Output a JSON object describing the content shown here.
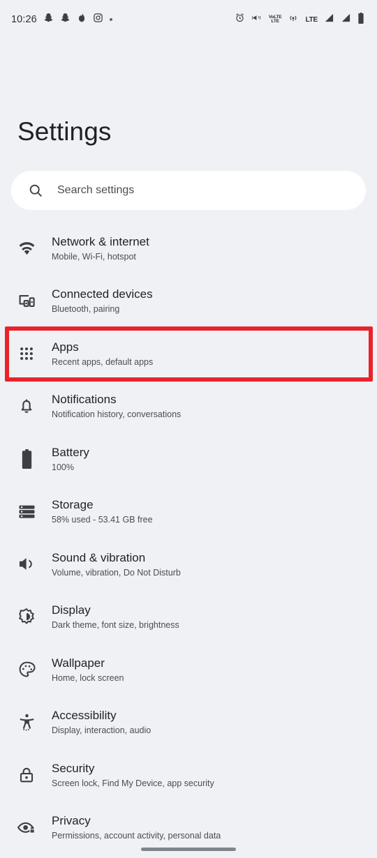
{
  "status_bar": {
    "time": "10:26",
    "left_icons": [
      {
        "name": "snapchat-icon",
        "label": "Snapchat"
      },
      {
        "name": "snapchat-icon",
        "label": "Snapchat"
      },
      {
        "name": "tinder-flame-icon",
        "label": "Tinder"
      },
      {
        "name": "instagram-icon",
        "label": "Instagram"
      },
      {
        "name": "more-notifications-dot-icon",
        "label": "More notifications"
      }
    ],
    "right_icons": [
      {
        "name": "alarm-clock-icon",
        "label": "Alarm set"
      },
      {
        "name": "vibrate-mode-icon",
        "label": "Vibrate"
      },
      {
        "name": "volte-icon",
        "label": "VoLTE",
        "text_top": "VoLTE",
        "text_bottom": "LTE"
      },
      {
        "name": "wifi-calling-icon",
        "label": "Wi-Fi calling"
      },
      {
        "name": "lte-label-icon",
        "label": "LTE",
        "text": "LTE"
      },
      {
        "name": "signal-bars-sim1-icon",
        "label": "Signal SIM 1"
      },
      {
        "name": "signal-bars-sim2-icon",
        "label": "Signal SIM 2"
      },
      {
        "name": "battery-icon",
        "label": "Battery"
      }
    ]
  },
  "header": {
    "title": "Settings"
  },
  "search": {
    "placeholder": "Search settings",
    "icon": "search-icon"
  },
  "settings_list": [
    {
      "icon": "wifi-icon",
      "title": "Network & internet",
      "subtitle": "Mobile, Wi-Fi, hotspot"
    },
    {
      "icon": "connected-devices-icon",
      "title": "Connected devices",
      "subtitle": "Bluetooth, pairing"
    },
    {
      "icon": "apps-grid-icon",
      "title": "Apps",
      "subtitle": "Recent apps, default apps",
      "highlighted": true
    },
    {
      "icon": "bell-icon",
      "title": "Notifications",
      "subtitle": "Notification history, conversations"
    },
    {
      "icon": "battery-icon",
      "title": "Battery",
      "subtitle": "100%"
    },
    {
      "icon": "storage-icon",
      "title": "Storage",
      "subtitle": "58% used - 53.41 GB free"
    },
    {
      "icon": "volume-icon",
      "title": "Sound & vibration",
      "subtitle": "Volume, vibration, Do Not Disturb"
    },
    {
      "icon": "brightness-icon",
      "title": "Display",
      "subtitle": "Dark theme, font size, brightness"
    },
    {
      "icon": "palette-icon",
      "title": "Wallpaper",
      "subtitle": "Home, lock screen"
    },
    {
      "icon": "accessibility-icon",
      "title": "Accessibility",
      "subtitle": "Display, interaction, audio"
    },
    {
      "icon": "lock-icon",
      "title": "Security",
      "subtitle": "Screen lock, Find My Device, app security"
    },
    {
      "icon": "privacy-eye-icon",
      "title": "Privacy",
      "subtitle": "Permissions, account activity, personal data"
    }
  ],
  "annotation": {
    "target": "Apps",
    "color": "#e8242a"
  },
  "colors": {
    "background": "#eff1f4",
    "search_background": "#ffffff",
    "title_text": "#1f2125",
    "subtitle_text": "#494d52",
    "icon": "#3c4043",
    "highlight": "#e8242a"
  }
}
